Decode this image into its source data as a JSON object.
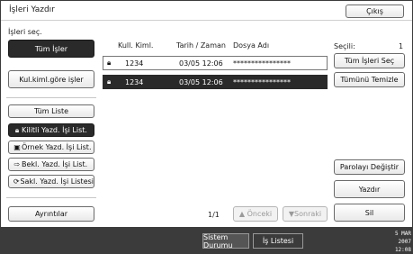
{
  "window": {
    "title": "İşleri Yazdır",
    "exit_label": "Çıkış"
  },
  "left": {
    "section_label": "İşleri seç.",
    "all_jobs": "Tüm İşler",
    "by_user": "Kul.kiml.göre işler",
    "full_list": "Tüm Liste",
    "locked_list": "Kilitli Yazd. İşi List.",
    "sample_list": "Örnek Yazd. İşi List.",
    "hold_list": "Bekl. Yazd. İşi List.",
    "stored_list": "Sakl. Yazd. İşi Listesi",
    "details": "Ayrıntılar"
  },
  "table": {
    "headers": {
      "user_id": "Kull. Kiml.",
      "datetime": "Tarih / Zaman",
      "filename": "Dosya Adı"
    },
    "rows": [
      {
        "user_id": "1234",
        "datetime": "03/05 12:06",
        "filename": "****************",
        "selected": false
      },
      {
        "user_id": "1234",
        "datetime": "03/05 12:06",
        "filename": "****************",
        "selected": true
      }
    ]
  },
  "pager": {
    "page": "1/1",
    "prev": "Önceki",
    "next": "Sonraki"
  },
  "right": {
    "selected_label": "Seçili:",
    "selected_count": "1",
    "select_all": "Tüm İşleri Seç",
    "clear_all": "Tümünü Temizle",
    "change_password": "Parolayı Değiştir",
    "print": "Yazdır",
    "delete": "Sil"
  },
  "statusbar": {
    "system_status": "Sistem Durumu",
    "job_list": "İş Listesi",
    "date": "5 MAR  2007",
    "time": "12:08"
  }
}
